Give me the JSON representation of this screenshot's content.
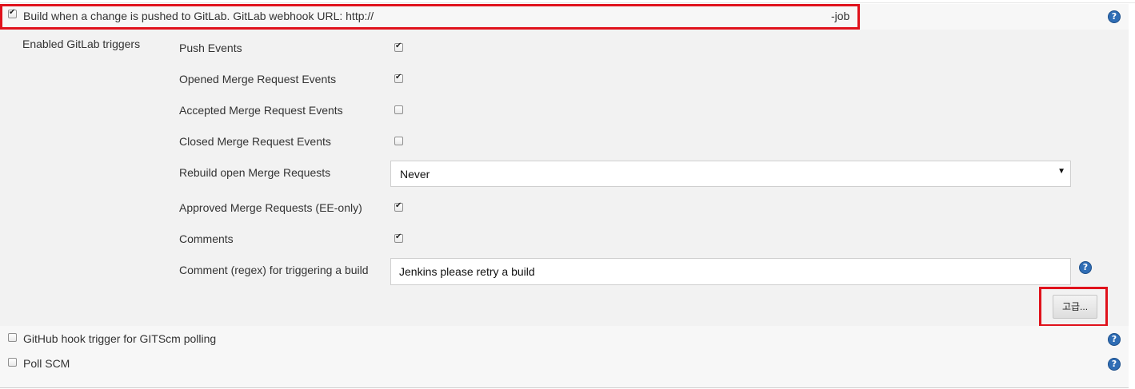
{
  "gitlab_trigger": {
    "enabled": true,
    "label_prefix": "Build when a change is pushed to GitLab. GitLab webhook URL: http://",
    "label_suffix": "-job"
  },
  "triggers_section": {
    "title": "Enabled GitLab triggers",
    "options": [
      {
        "label": "Push Events",
        "checked": true
      },
      {
        "label": "Opened Merge Request Events",
        "checked": true
      },
      {
        "label": "Accepted Merge Request Events",
        "checked": false
      },
      {
        "label": "Closed Merge Request Events",
        "checked": false
      }
    ],
    "rebuild": {
      "label": "Rebuild open Merge Requests",
      "selected": "Never"
    },
    "approved": {
      "label": "Approved Merge Requests (EE-only)",
      "checked": true
    },
    "comments": {
      "label": "Comments",
      "checked": true
    },
    "comment_regex": {
      "label": "Comment (regex) for triggering a build",
      "value": "Jenkins please retry a build"
    },
    "advanced_button": "고급..."
  },
  "other_triggers": [
    {
      "label": "GitHub hook trigger for GITScm polling",
      "checked": false
    },
    {
      "label": "Poll SCM",
      "checked": false
    }
  ],
  "colors": {
    "highlight": "#e0121c",
    "help_icon": "#2f6db5"
  }
}
